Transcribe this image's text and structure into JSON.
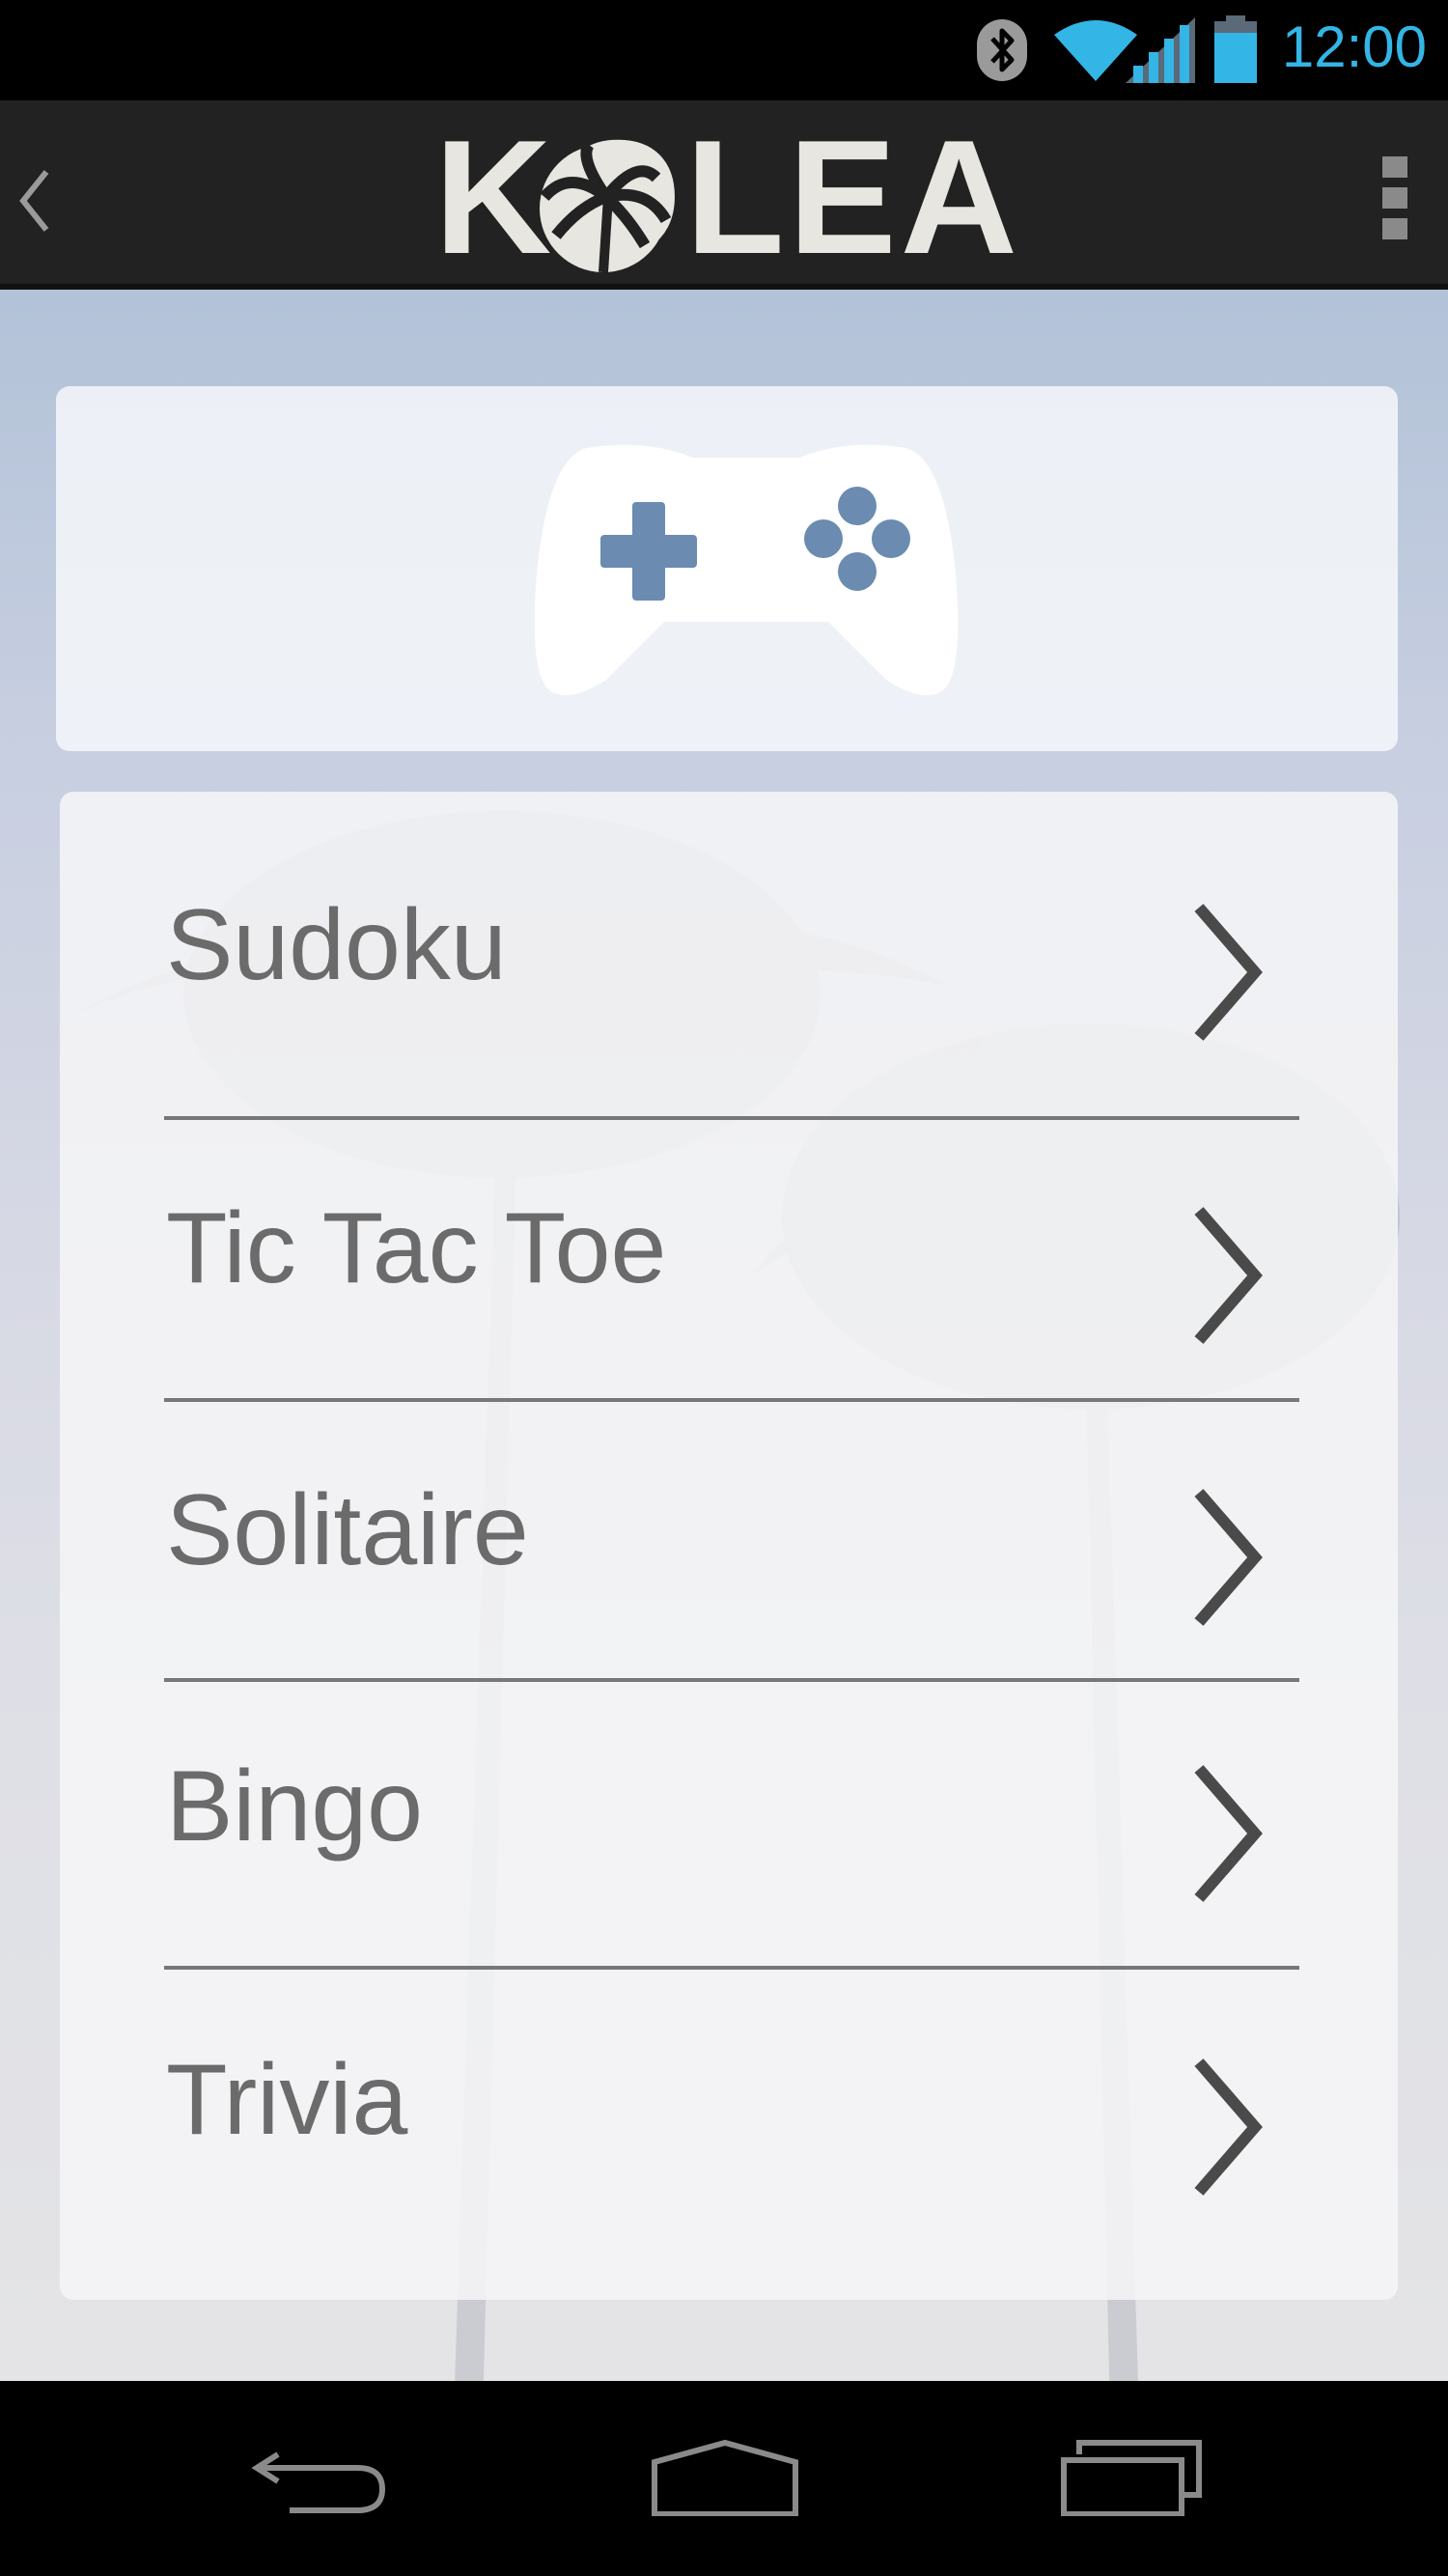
{
  "status_bar": {
    "time": "12:00",
    "icons": [
      "bluetooth-icon",
      "wifi-icon",
      "signal-icon",
      "battery-icon"
    ],
    "accent_color": "#33b5e5"
  },
  "action_bar": {
    "logo_text": "KOLEA",
    "up_icon": "chevron-left-icon",
    "overflow_icon": "overflow-menu-icon"
  },
  "header": {
    "icon": "game-controller-icon",
    "icon_color": "#6b8bb0"
  },
  "games": {
    "items": [
      {
        "label": "Sudoku"
      },
      {
        "label": "Tic Tac Toe"
      },
      {
        "label": "Solitaire"
      },
      {
        "label": "Bingo"
      },
      {
        "label": "Trivia"
      }
    ]
  },
  "nav_bar": {
    "buttons": [
      "back-icon",
      "home-icon",
      "recents-icon"
    ]
  }
}
